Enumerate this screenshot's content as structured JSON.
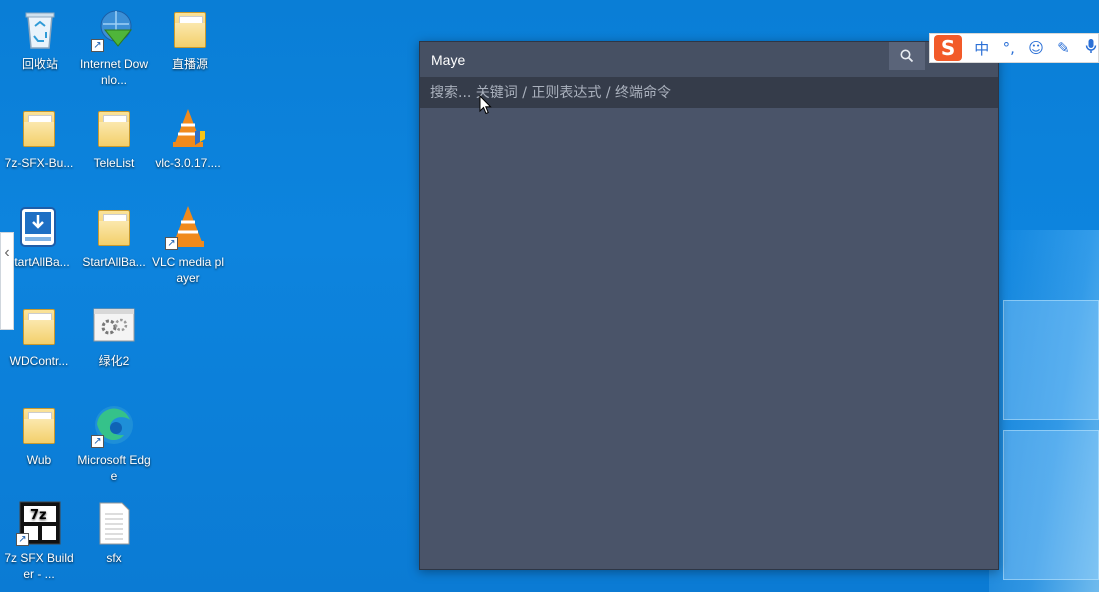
{
  "desktop": {
    "icons": [
      {
        "label": "回收站",
        "icon": "recycle-bin-icon"
      },
      {
        "label": "Internet Downlo...",
        "icon": "idm-icon"
      },
      {
        "label": "直播源",
        "icon": "folder-icon"
      },
      {
        "label": "7z-SFX-Bu...",
        "icon": "folder-icon"
      },
      {
        "label": "TeleList",
        "icon": "folder-icon"
      },
      {
        "label": "vlc-3.0.17....",
        "icon": "vlc-installer-icon"
      },
      {
        "label": "StartAllBa...",
        "icon": "startallback-icon"
      },
      {
        "label": "StartAllBa...",
        "icon": "folder-icon"
      },
      {
        "label": "VLC media player",
        "icon": "vlc-icon"
      },
      {
        "label": "WDContr...",
        "icon": "folder-icon"
      },
      {
        "label": "绿化2",
        "icon": "gear-window-icon"
      },
      {
        "label": "Wub",
        "icon": "folder-icon"
      },
      {
        "label": "Microsoft Edge",
        "icon": "edge-icon"
      },
      {
        "label": "7z SFX Builder - ...",
        "icon": "7z-sfx-icon"
      },
      {
        "label": "sfx",
        "icon": "text-file-icon"
      }
    ]
  },
  "maye": {
    "title": "Maye",
    "search_placeholder": "搜索... 关键词 / 正则表达式 / 终端命令",
    "search_icon": "search-icon"
  },
  "ime": {
    "logo": "S",
    "items": [
      "中",
      "°,",
      "☺",
      "✎",
      "🎤"
    ]
  },
  "colors": {
    "desktop_bg": "#0b7fd8",
    "maye_bg": "#4a5469",
    "maye_search_bg": "#353c4a",
    "ime_accent": "#f25a29"
  }
}
